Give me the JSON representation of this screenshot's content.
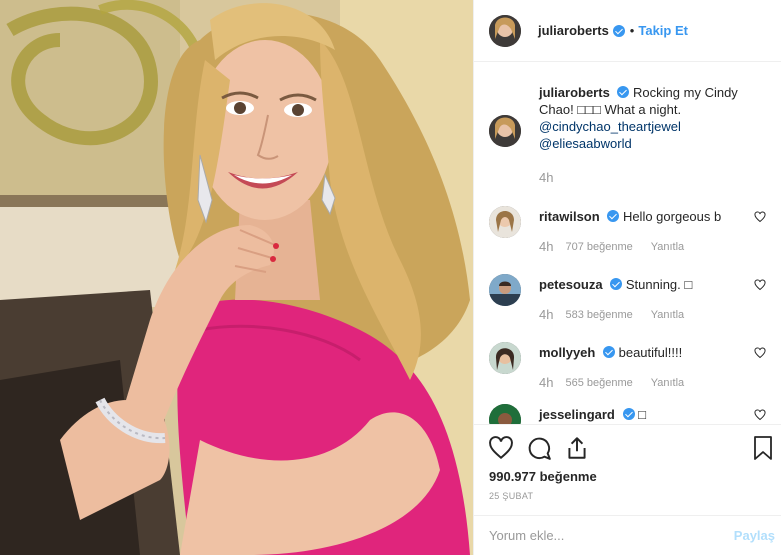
{
  "post": {
    "username": "juliaroberts",
    "follow_label": "Takip Et",
    "caption_text": "Rocking my Cindy Chao! □□□ What a night.",
    "mentions": [
      "@cindychao_theartjewel",
      "@eliesaabworld"
    ],
    "caption_time": "4h",
    "likes": "990.977 beğenme",
    "date": "25 ŞUBAT",
    "comment_placeholder": "Yorum ekle...",
    "post_label": "Paylaş"
  },
  "comments": [
    {
      "username": "ritawilson",
      "text": "Hello gorgeous b",
      "time": "4h",
      "likes": "707 beğenme",
      "reply": "Yanıtla"
    },
    {
      "username": "petesouza",
      "text": "Stunning. □",
      "time": "4h",
      "likes": "583 beğenme",
      "reply": "Yanıtla"
    },
    {
      "username": "mollyyeh",
      "text": "beautiful!!!!",
      "time": "4h",
      "likes": "565 beğenme",
      "reply": "Yanıtla"
    },
    {
      "username": "jesselingard",
      "text": "□",
      "time": "",
      "likes": "",
      "reply": ""
    }
  ],
  "colors": {
    "accent": "#3897f0",
    "dress": "#e0257c",
    "hair": "#d9b46a"
  }
}
